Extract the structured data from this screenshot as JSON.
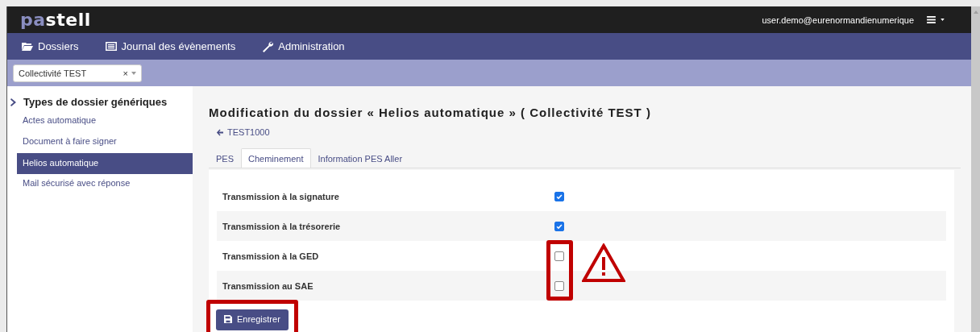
{
  "brand": {
    "part_1": "pa",
    "part_2": "stell"
  },
  "user": "user.demo@eurenormandienumerique",
  "nav": [
    {
      "label": "Dossiers"
    },
    {
      "label": "Journal des évènements"
    },
    {
      "label": "Administration"
    }
  ],
  "entity_select": {
    "value": "Collectivité TEST",
    "clear": "×"
  },
  "sidebar": {
    "heading": "Types de dossier génériques",
    "items": [
      {
        "label": "Actes automatique",
        "selected": false
      },
      {
        "label": "Document à faire signer",
        "selected": false
      },
      {
        "label": "Helios automatique",
        "selected": true
      },
      {
        "label": "Mail sécurisé avec réponse",
        "selected": false
      }
    ]
  },
  "page_title": "Modification du dossier « Helios automatique » ( Collectivité TEST )",
  "back_link": "TEST1000",
  "tabs": [
    {
      "label": "PES",
      "selected": false
    },
    {
      "label": "Cheminement",
      "selected": true
    },
    {
      "label": "Information PES Aller",
      "selected": false
    }
  ],
  "fields": [
    {
      "label": "Transmission à la signature",
      "checked": true,
      "highlighted": false
    },
    {
      "label": "Transmission à la trésorerie",
      "checked": true,
      "highlighted": false
    },
    {
      "label": "Transmission à la GED",
      "checked": false,
      "highlighted": true
    },
    {
      "label": "Transmission au SAE",
      "checked": false,
      "highlighted": true
    }
  ],
  "warning_sign": true,
  "save_button": {
    "label": "Enregistrer",
    "highlighted": true
  }
}
